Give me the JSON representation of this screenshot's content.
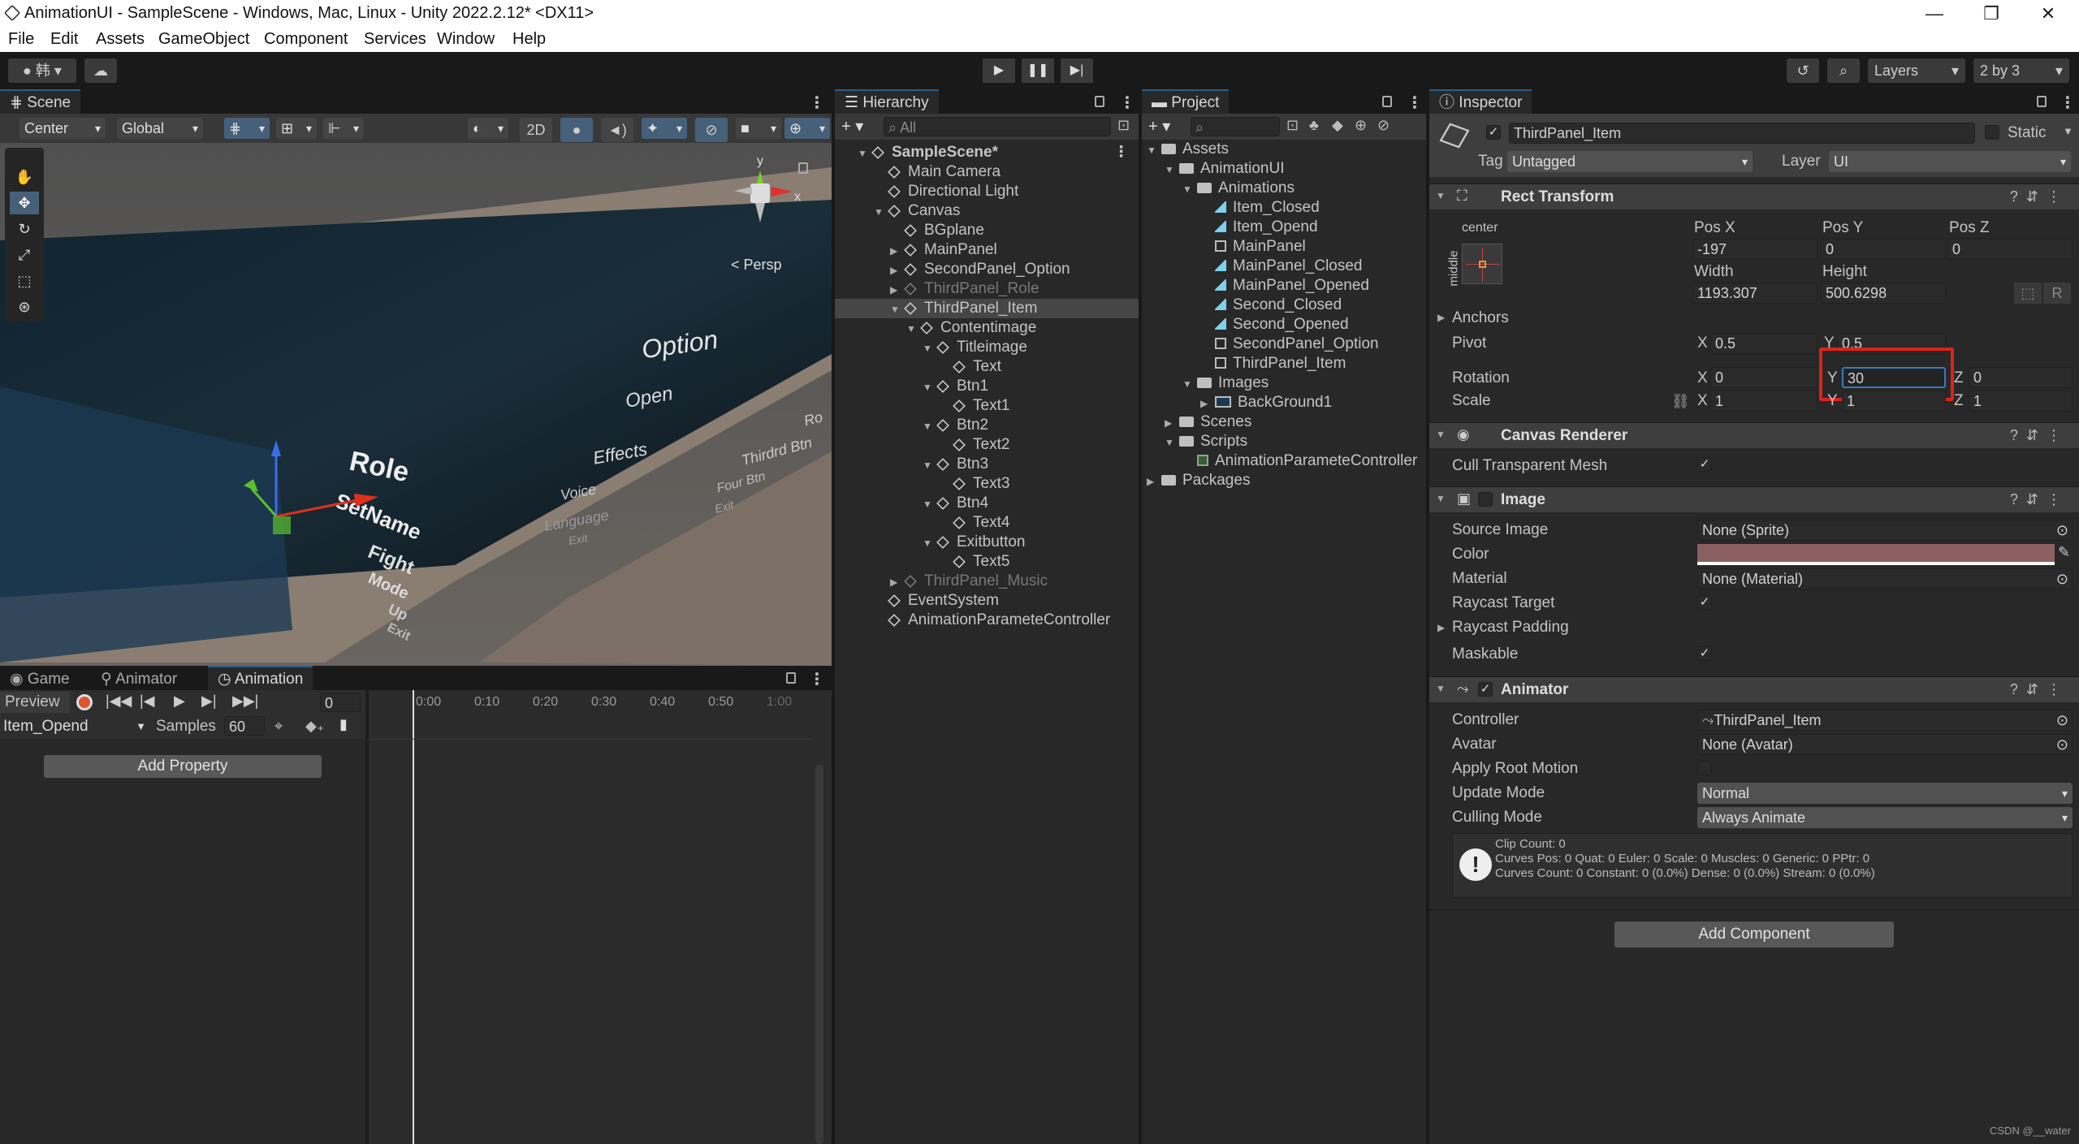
{
  "window": {
    "title": "AnimationUI - SampleScene - Windows, Mac, Linux - Unity 2022.2.12* <DX11>",
    "controls": [
      "—",
      "❐",
      "✕"
    ]
  },
  "menu": [
    "File",
    "Edit",
    "Assets",
    "GameObject",
    "Component",
    "Services",
    "Window",
    "Help"
  ],
  "toolbar": {
    "account_label": "韩",
    "layers_label": "Layers",
    "layout_label": "2 by 3"
  },
  "scene": {
    "tab": "Scene",
    "pivot_mode": "Center",
    "space_mode": "Global",
    "view2d": "2D",
    "persp_label": "< Persp",
    "gizmo_y": "y",
    "gizmo_x": "x",
    "texts": [
      "Option",
      "Open",
      "Effects",
      "Role",
      "SetName",
      "Fight",
      "Mode",
      "Up",
      "Exit",
      "Voice",
      "Language",
      "Exit",
      "Thirdrd Btn",
      "Four Btn",
      "Exit",
      "Ro"
    ]
  },
  "animation": {
    "tabs": [
      "Game",
      "Animator",
      "Animation"
    ],
    "preview_label": "Preview",
    "frame_value": "0",
    "clip": "Item_Opend",
    "samples_label": "Samples",
    "samples_value": "60",
    "add_property": "Add Property",
    "ticks": [
      "0:00",
      "0:10",
      "0:20",
      "0:30",
      "0:40",
      "0:50",
      "1:00"
    ]
  },
  "hierarchy": {
    "tab": "Hierarchy",
    "search_placeholder": "All",
    "items": [
      {
        "label": "SampleScene*",
        "depth": 0,
        "arrow": "▼",
        "bold": true,
        "dim": false
      },
      {
        "label": "Main Camera",
        "depth": 1,
        "arrow": "",
        "bold": false,
        "dim": false
      },
      {
        "label": "Directional Light",
        "depth": 1,
        "arrow": "",
        "bold": false,
        "dim": false
      },
      {
        "label": "Canvas",
        "depth": 1,
        "arrow": "▼",
        "bold": false,
        "dim": false
      },
      {
        "label": "BGplane",
        "depth": 2,
        "arrow": "",
        "bold": false,
        "dim": false
      },
      {
        "label": "MainPanel",
        "depth": 2,
        "arrow": "▶",
        "bold": false,
        "dim": false
      },
      {
        "label": "SecondPanel_Option",
        "depth": 2,
        "arrow": "▶",
        "bold": false,
        "dim": false
      },
      {
        "label": "ThirdPanel_Role",
        "depth": 2,
        "arrow": "▶",
        "bold": false,
        "dim": true
      },
      {
        "label": "ThirdPanel_Item",
        "depth": 2,
        "arrow": "▼",
        "bold": false,
        "dim": false,
        "selected": true
      },
      {
        "label": "Contentimage",
        "depth": 3,
        "arrow": "▼",
        "bold": false,
        "dim": false
      },
      {
        "label": "Titleimage",
        "depth": 4,
        "arrow": "▼",
        "bold": false,
        "dim": false
      },
      {
        "label": "Text",
        "depth": 5,
        "arrow": "",
        "bold": false,
        "dim": false
      },
      {
        "label": "Btn1",
        "depth": 4,
        "arrow": "▼",
        "bold": false,
        "dim": false
      },
      {
        "label": "Text1",
        "depth": 5,
        "arrow": "",
        "bold": false,
        "dim": false
      },
      {
        "label": "Btn2",
        "depth": 4,
        "arrow": "▼",
        "bold": false,
        "dim": false
      },
      {
        "label": "Text2",
        "depth": 5,
        "arrow": "",
        "bold": false,
        "dim": false
      },
      {
        "label": "Btn3",
        "depth": 4,
        "arrow": "▼",
        "bold": false,
        "dim": false
      },
      {
        "label": "Text3",
        "depth": 5,
        "arrow": "",
        "bold": false,
        "dim": false
      },
      {
        "label": "Btn4",
        "depth": 4,
        "arrow": "▼",
        "bold": false,
        "dim": false
      },
      {
        "label": "Text4",
        "depth": 5,
        "arrow": "",
        "bold": false,
        "dim": false
      },
      {
        "label": "Exitbutton",
        "depth": 4,
        "arrow": "▼",
        "bold": false,
        "dim": false
      },
      {
        "label": "Text5",
        "depth": 5,
        "arrow": "",
        "bold": false,
        "dim": false
      },
      {
        "label": "ThirdPanel_Music",
        "depth": 2,
        "arrow": "▶",
        "bold": false,
        "dim": true
      },
      {
        "label": "EventSystem",
        "depth": 1,
        "arrow": "",
        "bold": false,
        "dim": false
      },
      {
        "label": "AnimationParameteController",
        "depth": 1,
        "arrow": "",
        "bold": false,
        "dim": false
      }
    ]
  },
  "project": {
    "tab": "Project",
    "items": [
      {
        "label": "Assets",
        "depth": 0,
        "arrow": "▼",
        "icon": "folder"
      },
      {
        "label": "AnimationUI",
        "depth": 1,
        "arrow": "▼",
        "icon": "folder"
      },
      {
        "label": "Animations",
        "depth": 2,
        "arrow": "▼",
        "icon": "folder"
      },
      {
        "label": "Item_Closed",
        "depth": 3,
        "arrow": "",
        "icon": "anim"
      },
      {
        "label": "Item_Opend",
        "depth": 3,
        "arrow": "",
        "icon": "anim"
      },
      {
        "label": "MainPanel",
        "depth": 3,
        "arrow": "",
        "icon": "controller"
      },
      {
        "label": "MainPanel_Closed",
        "depth": 3,
        "arrow": "",
        "icon": "anim"
      },
      {
        "label": "MainPanel_Opened",
        "depth": 3,
        "arrow": "",
        "icon": "anim"
      },
      {
        "label": "Second_Closed",
        "depth": 3,
        "arrow": "",
        "icon": "anim"
      },
      {
        "label": "Second_Opened",
        "depth": 3,
        "arrow": "",
        "icon": "anim"
      },
      {
        "label": "SecondPanel_Option",
        "depth": 3,
        "arrow": "",
        "icon": "controller"
      },
      {
        "label": "ThirdPanel_Item",
        "depth": 3,
        "arrow": "",
        "icon": "controller"
      },
      {
        "label": "Images",
        "depth": 2,
        "arrow": "▼",
        "icon": "folder"
      },
      {
        "label": "BackGround1",
        "depth": 3,
        "arrow": "▶",
        "icon": "image"
      },
      {
        "label": "Scenes",
        "depth": 1,
        "arrow": "▶",
        "icon": "folder"
      },
      {
        "label": "Scripts",
        "depth": 1,
        "arrow": "▼",
        "icon": "folder"
      },
      {
        "label": "AnimationParameteController",
        "depth": 2,
        "arrow": "",
        "icon": "script"
      },
      {
        "label": "Packages",
        "depth": 0,
        "arrow": "▶",
        "icon": "folder"
      }
    ]
  },
  "inspector": {
    "tab": "Inspector",
    "object_name": "ThirdPanel_Item",
    "static_label": "Static",
    "tag_label": "Tag",
    "tag_value": "Untagged",
    "layer_label": "Layer",
    "layer_value": "UI",
    "rect": {
      "title": "Rect Transform",
      "anchor_h": "center",
      "anchor_v": "middle",
      "posx_label": "Pos X",
      "posy_label": "Pos Y",
      "posz_label": "Pos Z",
      "posx": "-197",
      "posy": "0",
      "posz": "0",
      "width_label": "Width",
      "height_label": "Height",
      "width": "1193.307",
      "height": "500.6298",
      "r_btn": "R",
      "anchors_label": "Anchors",
      "pivot_label": "Pivot",
      "pivot_x": "0.5",
      "pivot_y": "0.5",
      "rotation_label": "Rotation",
      "rot_x": "0",
      "rot_y": "30",
      "rot_z": "0",
      "scale_label": "Scale",
      "scale_x": "1",
      "scale_y": "1",
      "scale_z": "1",
      "x": "X",
      "y": "Y",
      "z": "Z"
    },
    "canvas_renderer": {
      "title": "Canvas Renderer",
      "cull_label": "Cull Transparent Mesh"
    },
    "image": {
      "title": "Image",
      "source_label": "Source Image",
      "source_value": "None (Sprite)",
      "color_label": "Color",
      "color_hex": "#8c6060",
      "material_label": "Material",
      "material_value": "None (Material)",
      "raycast_label": "Raycast Target",
      "padding_label": "Raycast Padding",
      "maskable_label": "Maskable"
    },
    "animator": {
      "title": "Animator",
      "controller_label": "Controller",
      "controller_value": "ThirdPanel_Item",
      "avatar_label": "Avatar",
      "avatar_value": "None (Avatar)",
      "root_motion_label": "Apply Root Motion",
      "update_label": "Update Mode",
      "update_value": "Normal",
      "culling_label": "Culling Mode",
      "culling_value": "Always Animate",
      "info_line1": "Clip Count: 0",
      "info_line2": "Curves Pos: 0 Quat: 0 Euler: 0 Scale: 0 Muscles: 0 Generic: 0 PPtr: 0",
      "info_line3": "Curves Count: 0 Constant: 0 (0.0%) Dense: 0 (0.0%) Stream: 0 (0.0%)"
    },
    "add_component": "Add Component"
  },
  "watermark": "CSDN @__water",
  "colors": {
    "highlight": "#e0201c",
    "selection": "#2c5d87",
    "accent_blue": "#3a79bb"
  }
}
